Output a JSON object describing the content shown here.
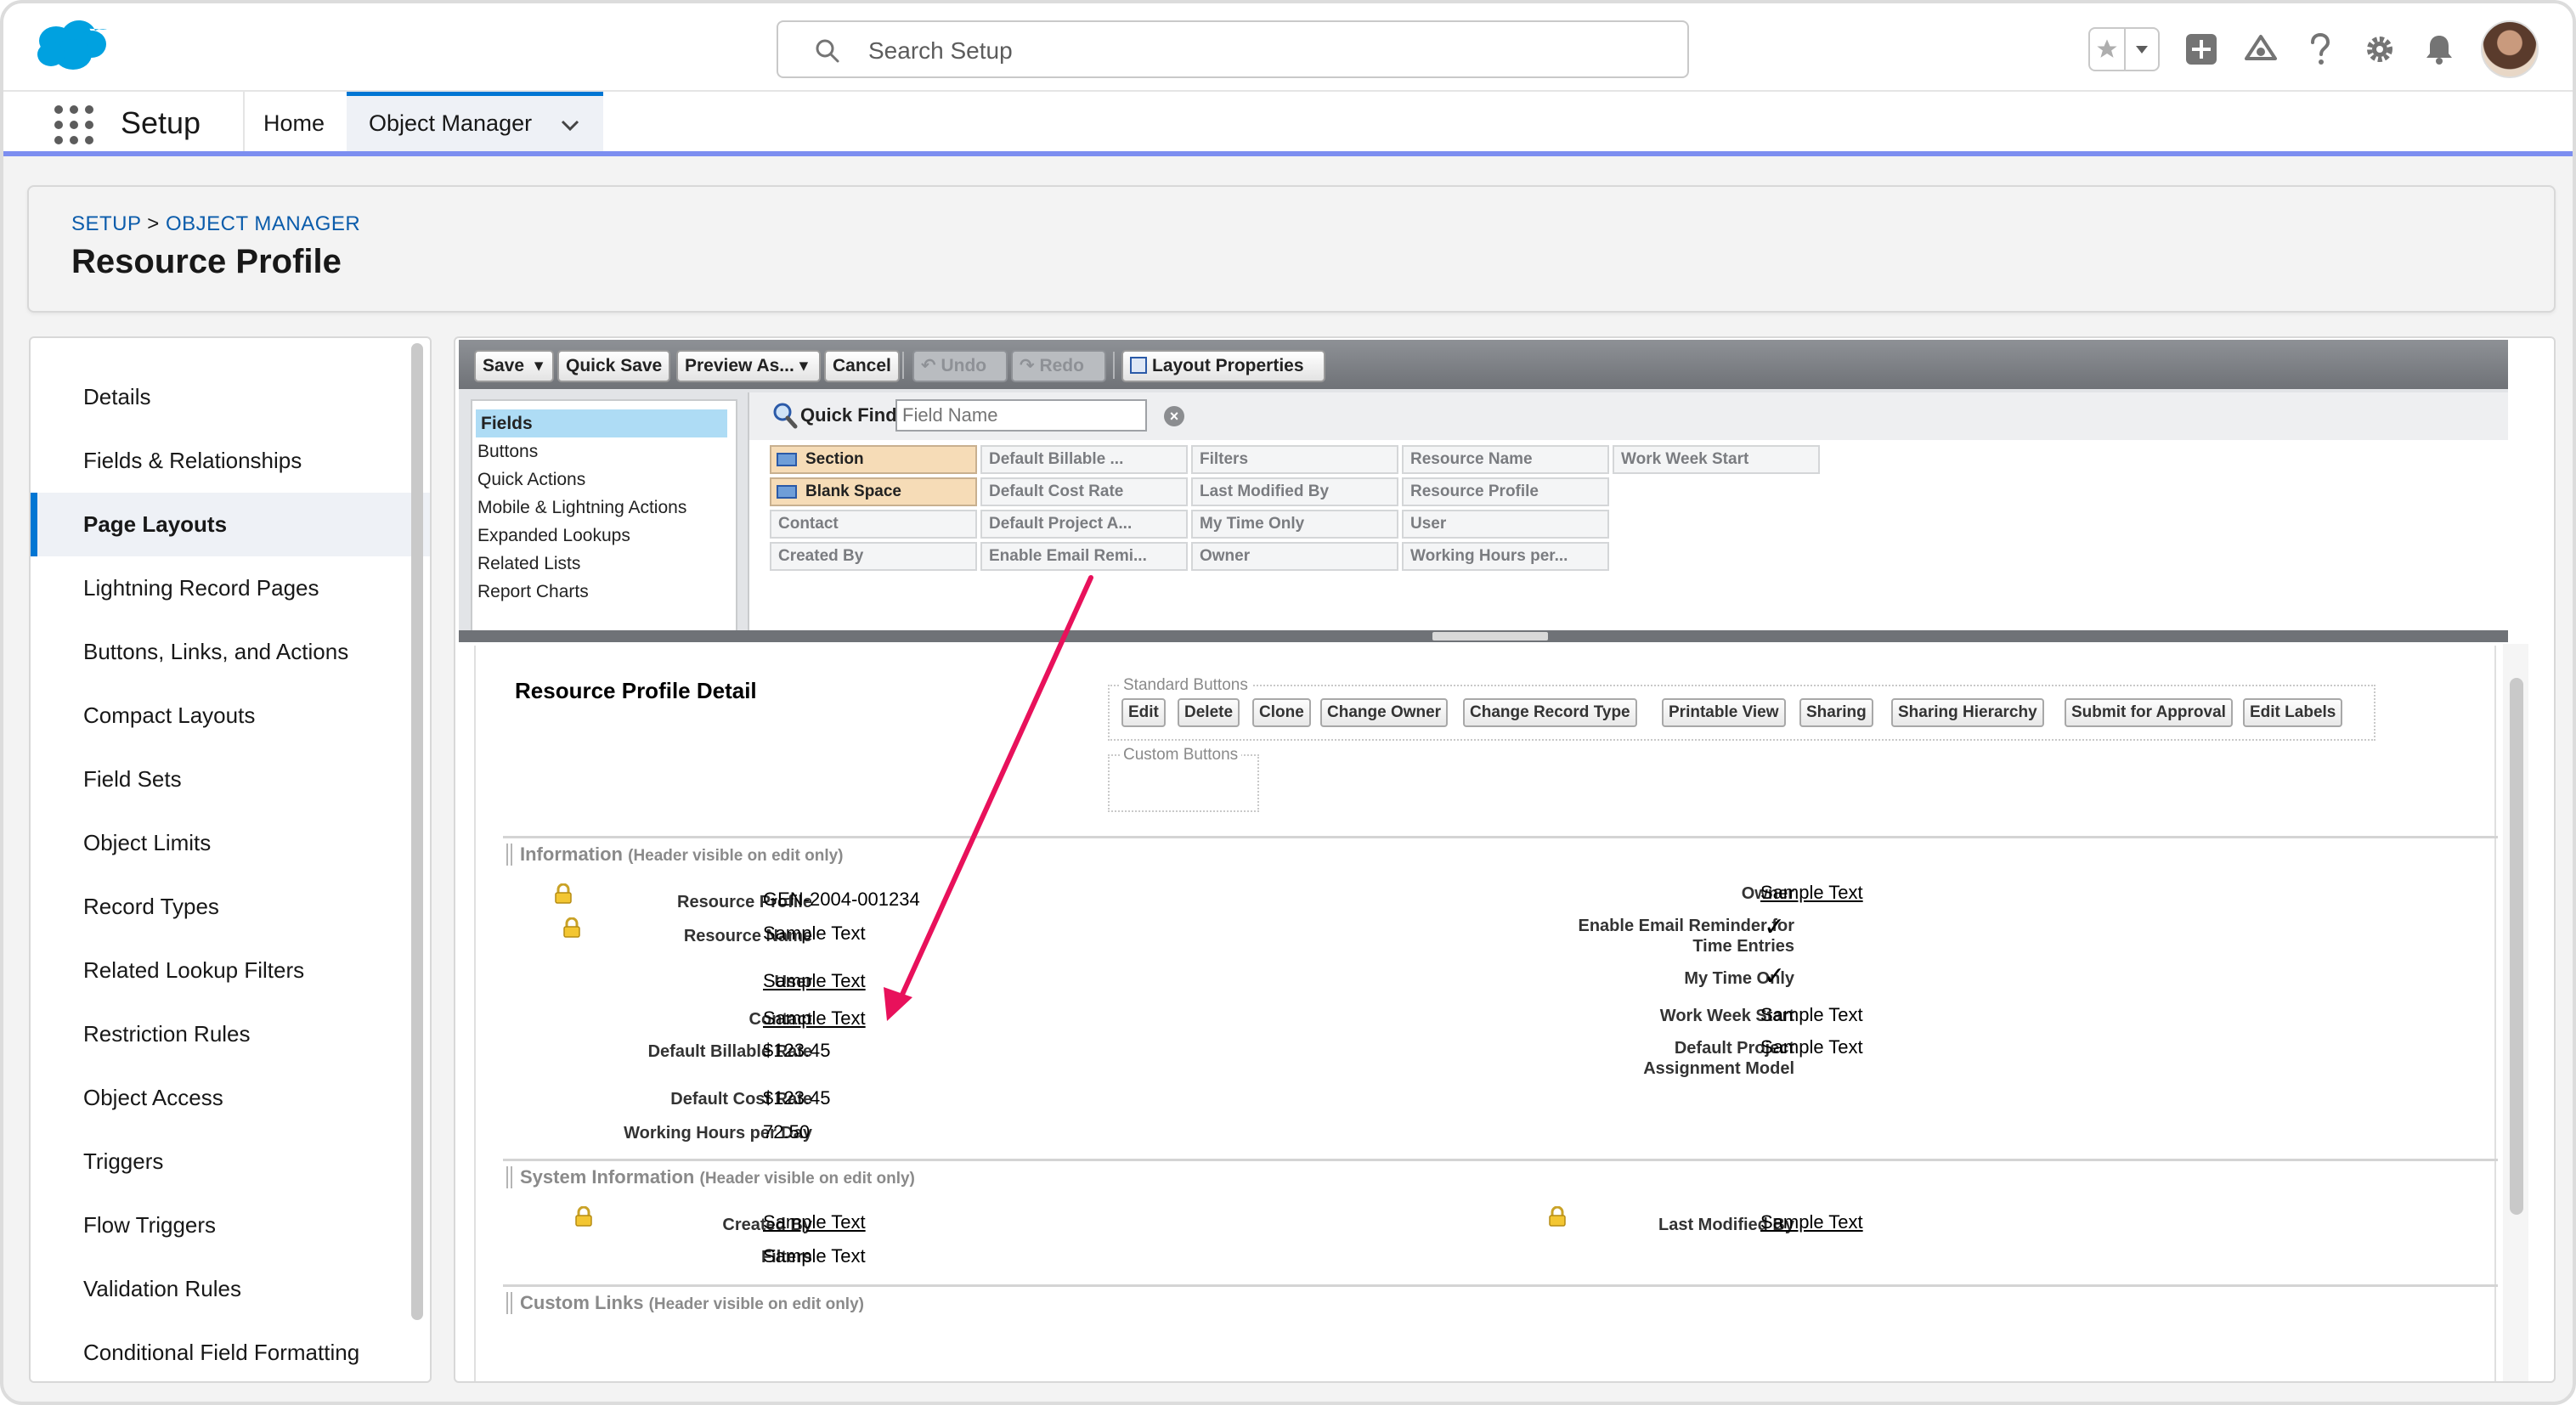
{
  "header": {
    "search_placeholder": "Search Setup",
    "icons": [
      "salesforce-logo",
      "search-icon",
      "star-icon",
      "chevron-down-icon",
      "plus-icon",
      "trailhead-icon",
      "help-icon",
      "gear-icon",
      "bell-icon",
      "avatar"
    ]
  },
  "context_bar": {
    "app_name": "Setup",
    "tabs": [
      {
        "label": "Home"
      },
      {
        "label": "Object Manager"
      }
    ]
  },
  "page_header": {
    "breadcrumb_setup": "SETUP",
    "breadcrumb_sep": ">",
    "breadcrumb_om": "OBJECT MANAGER",
    "title": "Resource Profile"
  },
  "left_nav": {
    "items": [
      {
        "label": "Details"
      },
      {
        "label": "Fields & Relationships"
      },
      {
        "label": "Page Layouts"
      },
      {
        "label": "Lightning Record Pages"
      },
      {
        "label": "Buttons, Links, and Actions"
      },
      {
        "label": "Compact Layouts"
      },
      {
        "label": "Field Sets"
      },
      {
        "label": "Object Limits"
      },
      {
        "label": "Record Types"
      },
      {
        "label": "Related Lookup Filters"
      },
      {
        "label": "Restriction Rules"
      },
      {
        "label": "Object Access"
      },
      {
        "label": "Triggers"
      },
      {
        "label": "Flow Triggers"
      },
      {
        "label": "Validation Rules"
      },
      {
        "label": "Conditional Field Formatting"
      }
    ],
    "active_index": 2
  },
  "toolbar": {
    "save": "Save",
    "quick_save": "Quick Save",
    "preview_as": "Preview As...",
    "cancel": "Cancel",
    "undo": "Undo",
    "redo": "Redo",
    "layout_properties": "Layout Properties"
  },
  "palette": {
    "categories": [
      "Fields",
      "Buttons",
      "Quick Actions",
      "Mobile & Lightning Actions",
      "Expanded Lookups",
      "Related Lists",
      "Report Charts"
    ],
    "quick_find_label": "Quick Find",
    "quick_find_placeholder": "Field Name",
    "items": [
      {
        "label": "Section"
      },
      {
        "label": "Blank Space"
      },
      {
        "label": "Contact"
      },
      {
        "label": "Created By"
      },
      {
        "label": "Default Billable ..."
      },
      {
        "label": "Default Cost Rate"
      },
      {
        "label": "Default Project A..."
      },
      {
        "label": "Enable Email Remi..."
      },
      {
        "label": "Filters"
      },
      {
        "label": "Last Modified By"
      },
      {
        "label": "My Time Only"
      },
      {
        "label": "Owner"
      },
      {
        "label": "Resource Name"
      },
      {
        "label": "Resource Profile"
      },
      {
        "label": "User"
      },
      {
        "label": "Working Hours per..."
      },
      {
        "label": "Work Week Start"
      }
    ]
  },
  "layout": {
    "detail_title": "Resource Profile Detail",
    "standard_buttons_legend": "Standard Buttons",
    "custom_buttons_legend": "Custom Buttons",
    "standard_buttons": [
      "Edit",
      "Delete",
      "Clone",
      "Change Owner",
      "Change Record Type",
      "Printable View",
      "Sharing",
      "Sharing Hierarchy",
      "Submit for Approval",
      "Edit Labels"
    ],
    "sections": [
      {
        "title": "Information",
        "note": "(Header visible on edit only)"
      },
      {
        "title": "System Information",
        "note": "(Header visible on edit only)"
      },
      {
        "title": "Custom Links",
        "note": "(Header visible on edit only)"
      }
    ],
    "info_left": [
      {
        "label": "Resource Profile",
        "value": "GEN-2004-001234"
      },
      {
        "label": "Resource Name",
        "value": "Sample Text"
      },
      {
        "label": "User",
        "value": "Sample Text"
      },
      {
        "label": "Contact",
        "value": "Sample Text"
      },
      {
        "label": "Default Billable Rate",
        "value": "$123.45"
      },
      {
        "label": "Default Cost Rate",
        "value": "$123.45"
      },
      {
        "label": "Working Hours per Day",
        "value": "72.50"
      }
    ],
    "info_right": [
      {
        "label": "Owner",
        "value": "Sample Text"
      },
      {
        "label": "Enable Email Reminder for Time Entries",
        "value": "✓"
      },
      {
        "label": "My Time Only",
        "value": "✓"
      },
      {
        "label": "Work Week Start",
        "value": "Sample Text"
      },
      {
        "label": "Default Project Assignment Model",
        "value": "Sample Text"
      }
    ],
    "sys_left": [
      {
        "label": "Created By",
        "value": "Sample Text"
      },
      {
        "label": "Filters",
        "value": "Sample Text"
      }
    ],
    "sys_right": [
      {
        "label": "Last Modified By",
        "value": "Sample Text"
      }
    ]
  },
  "colors": {
    "brand_blue": "#0176d3",
    "arrow": "#e8115b",
    "context_bar_underline": "#7c8ef0"
  }
}
